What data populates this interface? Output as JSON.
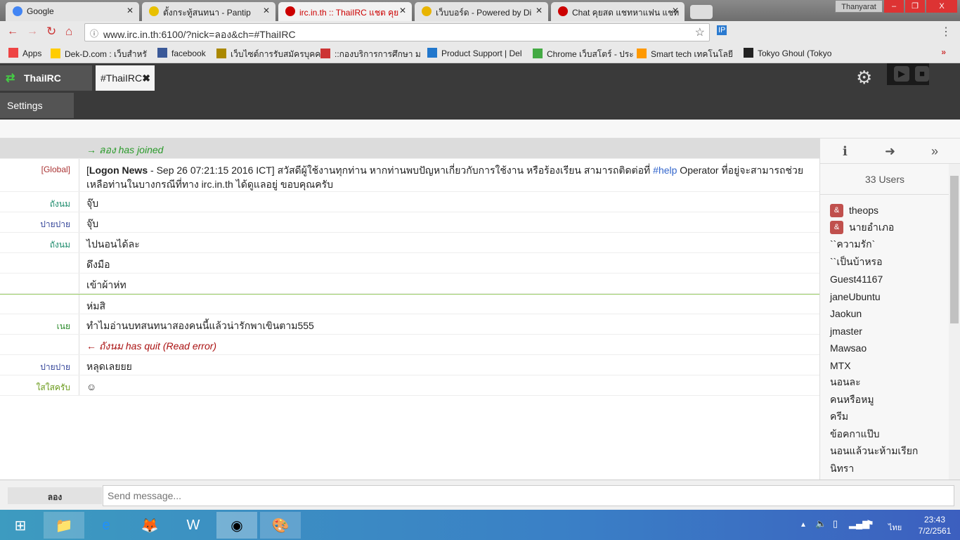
{
  "browser": {
    "tabs": [
      {
        "title": "Google",
        "icon": "google-icon",
        "color": "#4285f4"
      },
      {
        "title": "ตั้งกระทู้สนทนา - Pantip",
        "icon": "pantip-icon",
        "color": "#e8c000"
      },
      {
        "title": "irc.in.th :: ThaiIRC แชต คุย",
        "icon": "page-icon",
        "color": "#c00"
      },
      {
        "title": "เว็บบอร์ด - Powered by Di",
        "icon": "bulb-icon",
        "color": "#e8b400"
      },
      {
        "title": "Chat คุยสด แชทหาแฟน แชท",
        "icon": "page-icon",
        "color": "#c00"
      }
    ],
    "profile": "Thanyarat",
    "url": "www.irc.in.th:6100/?nick=ลอง&ch=#ThaiIRC",
    "bookmarks": [
      "Apps",
      "Dek-D.com : เว็บสำหรั",
      "facebook",
      "เว็บไซต์การรับสมัครบุคคล",
      "::กองบริการการศึกษา ม",
      "Product Support | Del",
      "Chrome เว็บสโตร์ - ประ",
      "Smart tech เทคโนโลยี",
      "Tokyo Ghoul (Tokyo"
    ]
  },
  "app": {
    "network": "ThaiIRC",
    "channel": "#ThaiIRC",
    "settings": "Settings",
    "messages": [
      {
        "nick": "",
        "text": "→ ลอง has joined",
        "type": "join",
        "color": "#2a9a2a"
      },
      {
        "nick": "[Global]",
        "bold": "Logon News",
        "text_pre": "[",
        "text_mid": " - Sep 26 07:21:15 2016 ICT] สวัสดีผู้ใช้งานทุกท่าน หากท่านพบปัญหาเกี่ยวกับการใช้งาน หรือร้องเรียน สามารถติดต่อที่ ",
        "link": "#help",
        "text_post": " Operator ที่อยู่จะสามารถช่วยเหลือท่านในบางกรณีที่ทาง irc.in.th ได้ดูแลอยู่ ขอบคุณครับ",
        "type": "global",
        "color": "#a33"
      },
      {
        "nick": "ถังนม",
        "text": "จุ๊บ",
        "color": "#1a8a6a"
      },
      {
        "nick": "ปายปาย",
        "text": "จุ๊บ",
        "color": "#334499"
      },
      {
        "nick": "ถังนม",
        "text": "ไปนอนได้ละ",
        "color": "#1a8a6a"
      },
      {
        "nick": "",
        "text": "ดึงมือ",
        "color": "#1a8a6a"
      },
      {
        "nick": "",
        "text": "เข้าผ้าห่ท",
        "color": "#1a8a6a"
      },
      {
        "nick": "",
        "text": "ห่มสิ",
        "color": "#1a8a6a",
        "divider": true
      },
      {
        "nick": "เนย",
        "text": "ทำไมอ่านบทสนทนาสองคนนี้แล้วน่ารักพาเขินตาม555",
        "color": "#2a8a2a"
      },
      {
        "nick": "",
        "text": "← ถังนม has quit (Read error)",
        "type": "quit",
        "color": "#aa1111"
      },
      {
        "nick": "ปายปาย",
        "text": "หลุดเลยยย",
        "color": "#334499"
      },
      {
        "nick": "ใสใสครับ",
        "text": "☺",
        "color": "#6a9a1a"
      }
    ],
    "user_count": "33 Users",
    "users": [
      {
        "name": "theops",
        "op": "&"
      },
      {
        "name": "นายอำเภอ",
        "op": "&"
      },
      {
        "name": "``ความรัก`"
      },
      {
        "name": "``เป็นบ้าหรอ"
      },
      {
        "name": "Guest41167"
      },
      {
        "name": "janeUbuntu"
      },
      {
        "name": "Jaokun"
      },
      {
        "name": "jmaster"
      },
      {
        "name": "Mawsao"
      },
      {
        "name": "MTX"
      },
      {
        "name": "นอนละ"
      },
      {
        "name": "คนหรือหมู"
      },
      {
        "name": "ครีม"
      },
      {
        "name": "ข้อคกาแป๊บ"
      },
      {
        "name": "นอนแล้วนะห้ามเรียก"
      },
      {
        "name": "นิทรา"
      }
    ],
    "my_nick": "ลอง",
    "input_placeholder": "Send message..."
  },
  "taskbar": {
    "lang": "ไทย",
    "time": "23:43",
    "date": "7/2/2561"
  }
}
